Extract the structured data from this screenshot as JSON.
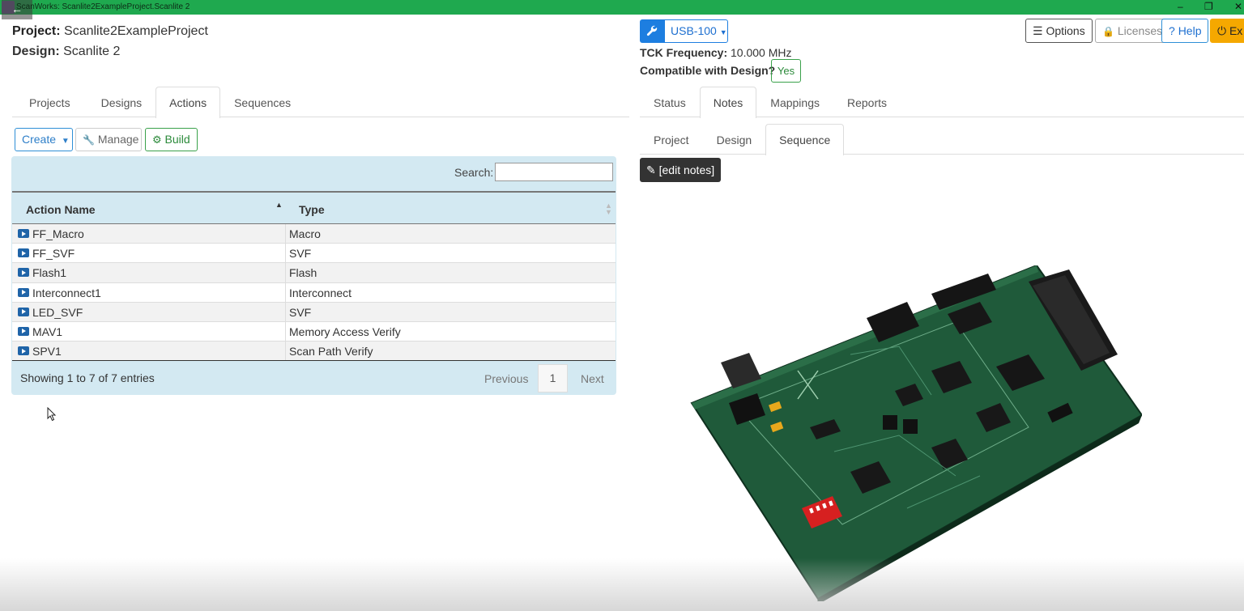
{
  "window": {
    "title": "ScanWorks: Scanlite2ExampleProject.Scanlite 2",
    "back_glyph": "←",
    "minimize_glyph": "–",
    "restore_glyph": "❐",
    "close_glyph": "✕"
  },
  "header": {
    "project_label": "Project:",
    "project_value": "Scanlite2ExampleProject",
    "design_label": "Design:",
    "design_value": "Scanlite 2"
  },
  "left_tabs": [
    {
      "label": "Projects",
      "active": false
    },
    {
      "label": "Designs",
      "active": false
    },
    {
      "label": "Actions",
      "active": true
    },
    {
      "label": "Sequences",
      "active": false
    }
  ],
  "toolbar": {
    "create_label": "Create",
    "manage_label": "Manage",
    "build_label": "Build"
  },
  "search": {
    "label": "Search:",
    "value": ""
  },
  "table": {
    "columns": [
      "Action Name",
      "Type"
    ],
    "rows": [
      {
        "name": "FF_Macro",
        "type": "Macro"
      },
      {
        "name": "FF_SVF",
        "type": "SVF"
      },
      {
        "name": "Flash1",
        "type": "Flash"
      },
      {
        "name": "Interconnect1",
        "type": "Interconnect"
      },
      {
        "name": "LED_SVF",
        "type": "SVF"
      },
      {
        "name": "MAV1",
        "type": "Memory Access Verify"
      },
      {
        "name": "SPV1",
        "type": "Scan Path Verify"
      }
    ],
    "showing": "Showing 1 to 7 of 7 entries",
    "previous": "Previous",
    "page": "1",
    "next": "Next"
  },
  "controller": {
    "device": "USB-100",
    "tck_label": "TCK Frequency:",
    "tck_value": "10.000 MHz",
    "compat_label": "Compatible with Design?",
    "compat_value": "Yes"
  },
  "top_right": {
    "options": "Options",
    "licenses": "Licenses",
    "help": "Help",
    "exit": "Exit"
  },
  "right_tabs": [
    {
      "label": "Status",
      "active": false
    },
    {
      "label": "Notes",
      "active": true
    },
    {
      "label": "Mappings",
      "active": false
    },
    {
      "label": "Reports",
      "active": false
    }
  ],
  "notes_tabs": [
    {
      "label": "Project",
      "active": false
    },
    {
      "label": "Design",
      "active": false
    },
    {
      "label": "Sequence",
      "active": true
    }
  ],
  "edit_notes": "[edit notes]",
  "colors": {
    "titlebar": "#1fa94f",
    "panel": "#d3e9f2",
    "primary": "#1d7ee0",
    "exit": "#f5a800",
    "board": "#1f5a3a"
  }
}
